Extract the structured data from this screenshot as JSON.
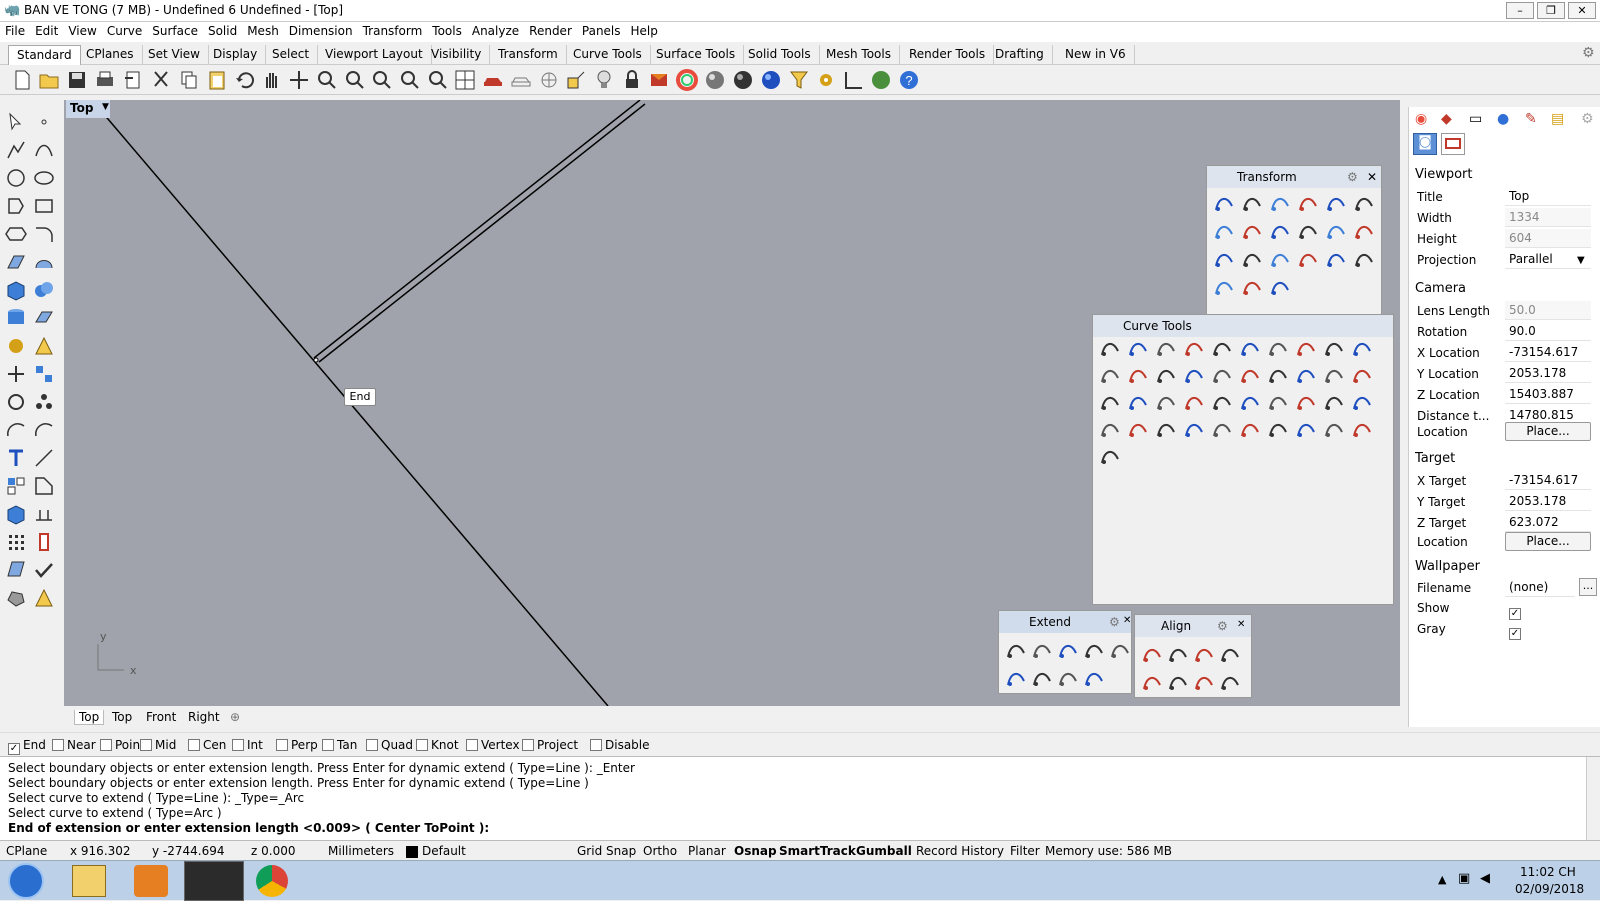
{
  "window": {
    "title": "BAN VE TONG (7 MB) - Undefined 6 Undefined - [Top]",
    "min": "–",
    "max": "❐",
    "close": "✕"
  },
  "menu": [
    "File",
    "Edit",
    "View",
    "Curve",
    "Surface",
    "Solid",
    "Mesh",
    "Dimension",
    "Transform",
    "Tools",
    "Analyze",
    "Render",
    "Panels",
    "Help"
  ],
  "tabs": [
    "Standard",
    "CPlanes",
    "Set View",
    "Display",
    "Select",
    "Viewport Layout",
    "Visibility",
    "Transform",
    "Curve Tools",
    "Surface Tools",
    "Solid Tools",
    "Mesh Tools",
    "Render Tools",
    "Drafting",
    "New in V6"
  ],
  "viewport": {
    "title": "Top",
    "tooltip": "End",
    "axis_x": "x",
    "axis_y": "y",
    "bg": "#a0a3ab"
  },
  "viewport_tabs": [
    "Top",
    "Top",
    "Front",
    "Right"
  ],
  "viewport_add": "⊕",
  "osnaps": [
    {
      "label": "End",
      "checked": true
    },
    {
      "label": "Near",
      "checked": false
    },
    {
      "label": "Point",
      "checked": false
    },
    {
      "label": "Mid",
      "checked": false
    },
    {
      "label": "Cen",
      "checked": false
    },
    {
      "label": "Int",
      "checked": false
    },
    {
      "label": "Perp",
      "checked": false
    },
    {
      "label": "Tan",
      "checked": false
    },
    {
      "label": "Quad",
      "checked": false
    },
    {
      "label": "Knot",
      "checked": false
    },
    {
      "label": "Vertex",
      "checked": false
    },
    {
      "label": "Project",
      "checked": false
    },
    {
      "label": "Disable",
      "checked": false
    }
  ],
  "command_history": [
    "Select boundary objects or enter extension length. Press Enter for dynamic extend ( Type=Line ): _Enter",
    "Select boundary objects or enter extension length. Press Enter for dynamic extend ( Type=Line )",
    "Select curve to extend ( Type=Line ): _Type=_Arc",
    "Select curve to extend ( Type=Arc )"
  ],
  "command_prompt": "End of extension or enter extension length <0.009> ( Center  ToPoint ):",
  "status": {
    "cplane": "CPlane",
    "x": "x 916.302",
    "y": "y -2744.694",
    "z": "z 0.000",
    "units": "Millimeters",
    "layer": "Default",
    "grid_snap": "Grid Snap",
    "ortho": "Ortho",
    "planar": "Planar",
    "osnap": "Osnap",
    "smarttrack": "SmartTrack",
    "gumball": "Gumball",
    "record_history": "Record History",
    "filter": "Filter",
    "memory": "Memory use: 586 MB"
  },
  "panels": {
    "transform": "Transform",
    "curve_tools": "Curve Tools",
    "extend": "Extend",
    "align": "Align"
  },
  "properties": {
    "viewport_section": "Viewport",
    "rows1": [
      {
        "label": "Title",
        "value": "Top",
        "disabled": false
      },
      {
        "label": "Width",
        "value": "1334",
        "disabled": true
      },
      {
        "label": "Height",
        "value": "604",
        "disabled": true
      },
      {
        "label": "Projection",
        "value": "Parallel",
        "disabled": false
      }
    ],
    "camera_section": "Camera",
    "rows2": [
      {
        "label": "Lens Length",
        "value": "50.0",
        "disabled": true
      },
      {
        "label": "Rotation",
        "value": "90.0",
        "disabled": false
      },
      {
        "label": "X Location",
        "value": "-73154.617",
        "disabled": false
      },
      {
        "label": "Y Location",
        "value": "2053.178",
        "disabled": false
      },
      {
        "label": "Z Location",
        "value": "15403.887",
        "disabled": false
      },
      {
        "label": "Distance t...",
        "value": "14780.815",
        "disabled": false
      }
    ],
    "location_label": "Location",
    "place_btn": "Place...",
    "target_section": "Target",
    "rows3": [
      {
        "label": "X Target",
        "value": "-73154.617",
        "disabled": false
      },
      {
        "label": "Y Target",
        "value": "2053.178",
        "disabled": false
      },
      {
        "label": "Z Target",
        "value": "623.072",
        "disabled": false
      }
    ],
    "wallpaper_section": "Wallpaper",
    "filename_label": "Filename",
    "filename_value": "(none)",
    "browse": "...",
    "show_label": "Show",
    "gray_label": "Gray"
  },
  "clock": {
    "time": "11:02 CH",
    "date": "02/09/2018"
  }
}
